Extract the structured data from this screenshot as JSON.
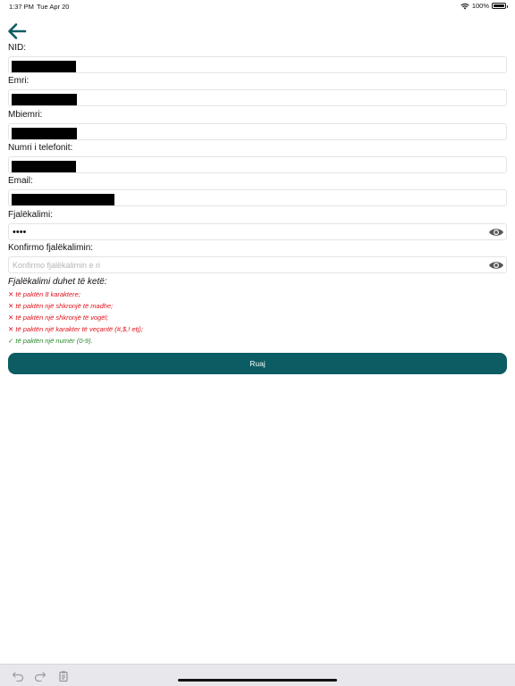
{
  "status_bar": {
    "time": "1:37 PM",
    "date": "Tue Apr 20",
    "battery": "100%"
  },
  "icons": {
    "back": "arrow-left-icon",
    "eye": "eye-icon",
    "wifi": "wifi-icon"
  },
  "colors": {
    "accent": "#0c5c63",
    "error": "#e0141e",
    "success": "#2a8a2a"
  },
  "form": {
    "nid": {
      "label": "NID:"
    },
    "first_name": {
      "label": "Emri:"
    },
    "last_name": {
      "label": "Mbiemri:"
    },
    "phone": {
      "label": "Numri i telefonit:"
    },
    "email": {
      "label": "Email:"
    },
    "password": {
      "label": "Fjalëkalimi:",
      "value": "••••"
    },
    "confirm_password": {
      "label": "Konfirmo fjalëkalimin:",
      "placeholder": "Konfirmo fjalëkalimin e ri"
    }
  },
  "rules": {
    "title": "Fjalëkalimi duhet të ketë:",
    "items": [
      {
        "mark": "✕",
        "text": "të paktën 8 karaktere;",
        "status": "fail"
      },
      {
        "mark": "✕",
        "text": "të paktën një shkronjë të madhe;",
        "status": "fail"
      },
      {
        "mark": "✕",
        "text": "të paktën një shkronjë të vogël;",
        "status": "fail"
      },
      {
        "mark": "✕",
        "text": "të paktën një karakter të veçantë (#,$,! etj);",
        "status": "fail"
      },
      {
        "mark": "✓",
        "text": "të paktën një numër (0-9).",
        "status": "pass"
      }
    ]
  },
  "save_button": {
    "label": "Ruaj"
  },
  "bottom_bar": {
    "undo": "undo-icon",
    "redo": "redo-icon",
    "clipboard": "clipboard-icon"
  }
}
